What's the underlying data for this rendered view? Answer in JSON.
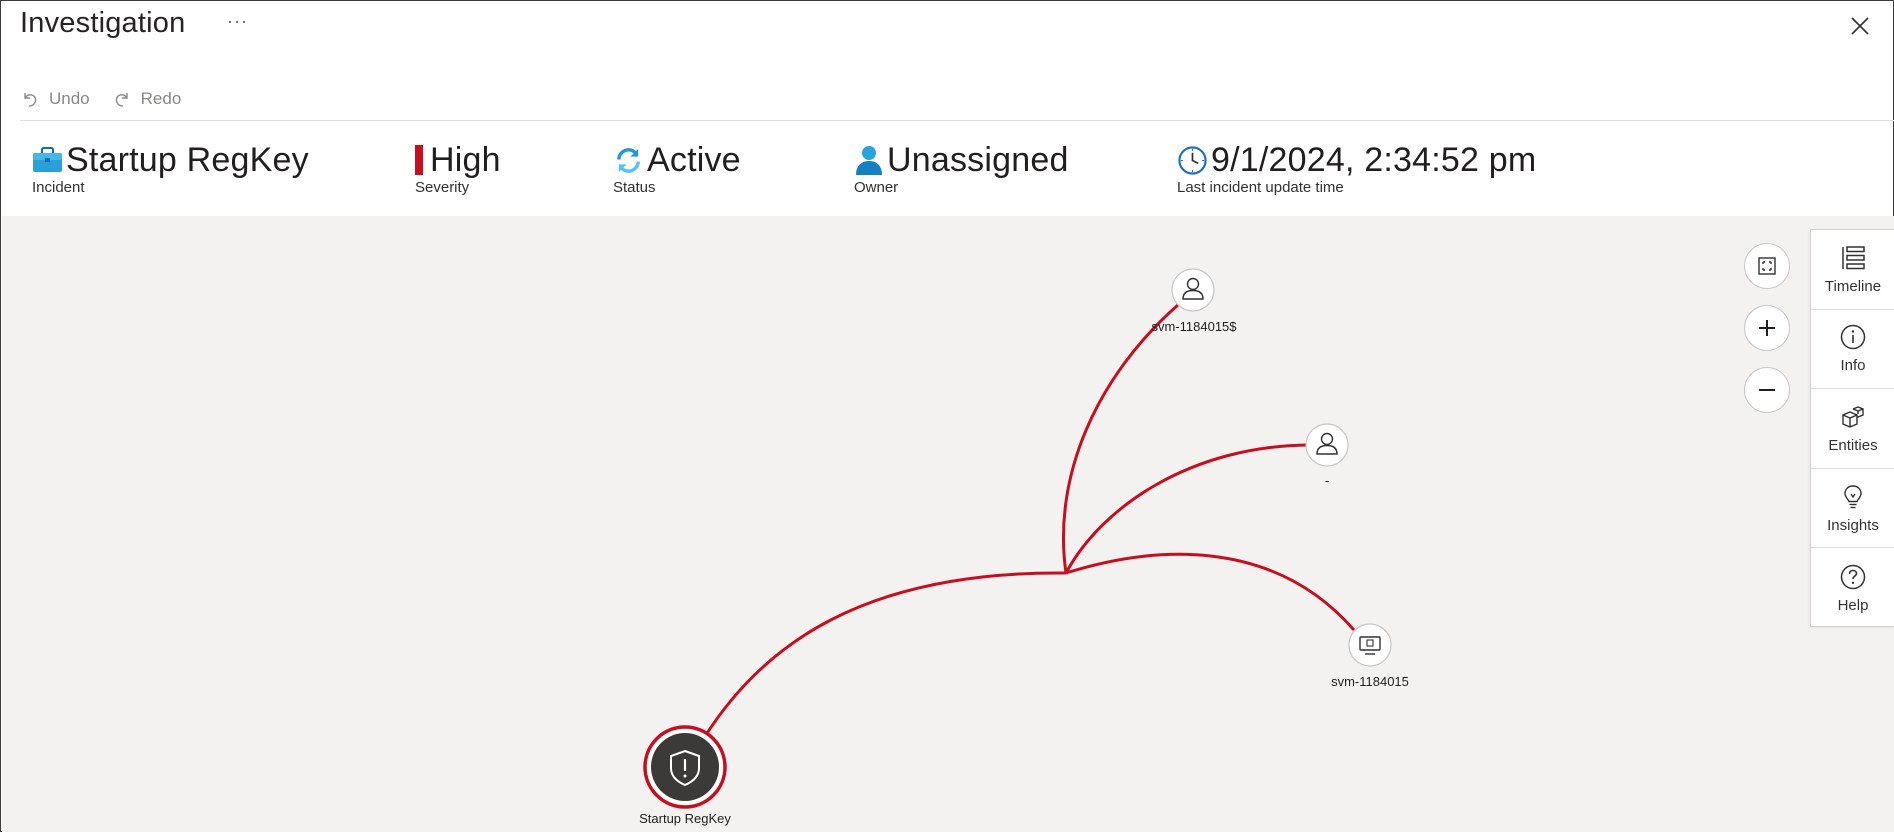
{
  "header": {
    "title": "Investigation",
    "more_label": "···"
  },
  "toolbar": {
    "undo_label": "Undo",
    "redo_label": "Redo"
  },
  "summary": {
    "incident": {
      "value": "Startup RegKey",
      "label": "Incident",
      "icon": "briefcase-icon"
    },
    "severity": {
      "value": "High",
      "label": "Severity",
      "color": "#c50f1f"
    },
    "status": {
      "value": "Active",
      "label": "Status",
      "icon": "refresh-icon"
    },
    "owner": {
      "value": "Unassigned",
      "label": "Owner",
      "icon": "user-icon"
    },
    "updated": {
      "value": "9/1/2024, 2:34:52 pm",
      "label": "Last incident update time",
      "icon": "clock-icon"
    }
  },
  "graph": {
    "edge_color": "#c50f1f",
    "nodes": [
      {
        "id": "alert",
        "label": "Startup RegKey",
        "icon": "shield-alert-icon"
      },
      {
        "id": "user1",
        "label": "svm-1184015$",
        "icon": "user-icon"
      },
      {
        "id": "user2",
        "label": "-",
        "icon": "user-icon"
      },
      {
        "id": "device",
        "label": "svm-1184015",
        "icon": "device-icon"
      }
    ]
  },
  "side_panel": {
    "items": [
      {
        "label": "Timeline",
        "icon": "timeline-icon"
      },
      {
        "label": "Info",
        "icon": "info-icon"
      },
      {
        "label": "Entities",
        "icon": "entities-icon"
      },
      {
        "label": "Insights",
        "icon": "lightbulb-icon"
      },
      {
        "label": "Help",
        "icon": "help-icon"
      }
    ]
  }
}
